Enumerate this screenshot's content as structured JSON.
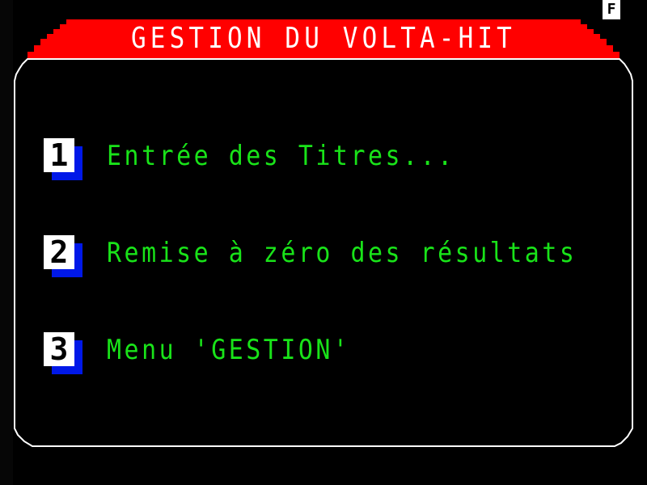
{
  "header": {
    "title": "GESTION DU VOLTA-HIT",
    "corner_badge": "F",
    "color": "#ff0000"
  },
  "frame": {
    "color": "#ffffff"
  },
  "menu": {
    "items": [
      {
        "key": "1",
        "label": "Entrée des Titres..."
      },
      {
        "key": "2",
        "label": "Remise à zéro des résultats"
      },
      {
        "key": "3",
        "label": "Menu 'GESTION'"
      }
    ],
    "label_color": "#19e319",
    "key_shadow_color": "#0018e8"
  }
}
